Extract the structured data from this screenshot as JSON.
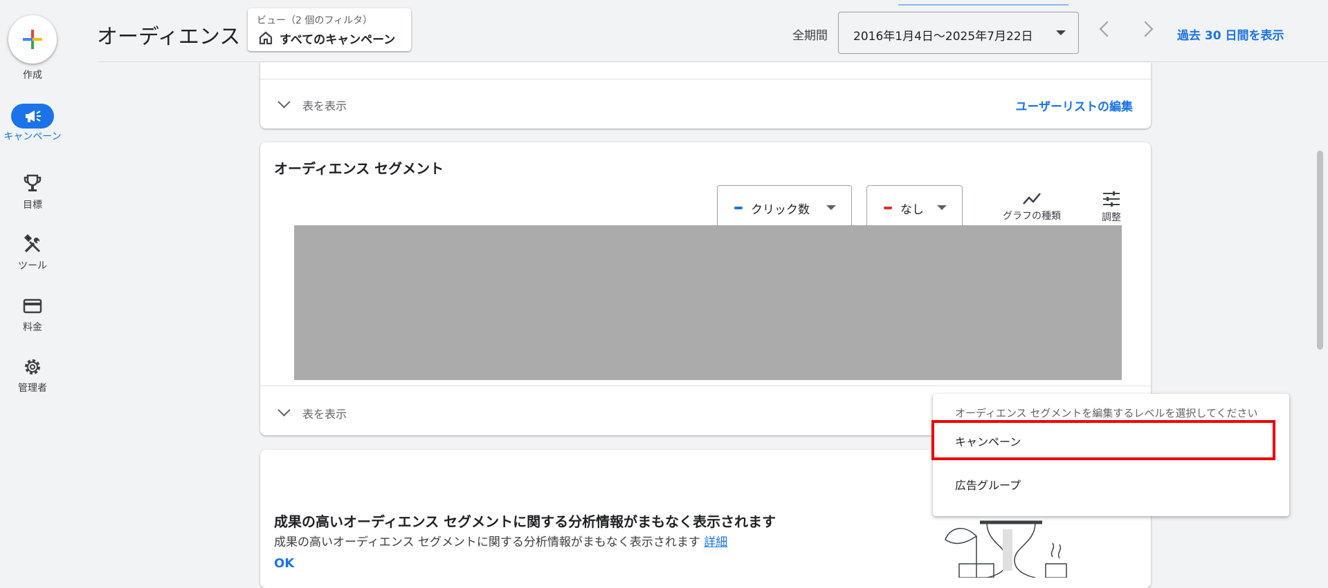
{
  "nav": {
    "create_label": "作成",
    "items": [
      {
        "label": "キャンペーン",
        "icon": "megaphone-icon",
        "active": true
      },
      {
        "label": "目標",
        "icon": "trophy-icon"
      },
      {
        "label": "ツール",
        "icon": "tools-icon"
      },
      {
        "label": "料金",
        "icon": "credit-card-icon"
      },
      {
        "label": "管理者",
        "icon": "gear-icon"
      }
    ]
  },
  "header": {
    "title": "オーディエンス",
    "view_chip": {
      "sub": "ビュー（2 個のフィルタ）",
      "main": "すべてのキャンペーン",
      "icon": "home-icon"
    },
    "period_label": "全期間",
    "date_range": "2016年1月4日～2025年7月22日",
    "past30_label": "過去 30 日間を表示"
  },
  "card_userlist": {
    "show_table": "表を表示",
    "edit_link": "ユーザーリストの編集"
  },
  "card_segments": {
    "title": "オーディエンス セグメント",
    "metric1": {
      "label": "クリック数",
      "color": "#1a73e8"
    },
    "metric2": {
      "label": "なし",
      "color": "#d93025"
    },
    "chart_type_label": "グラフの種類",
    "adjust_label": "調整",
    "show_table": "表を表示"
  },
  "card_insights": {
    "heading": "成果の高いオーディエンス セグメントに関する分析情報がまもなく表示されます",
    "text": "成果の高いオーディエンス セグメントに関する分析情報がまもなく表示されます",
    "link": "詳細",
    "ok": "OK"
  },
  "menu": {
    "hint": "オーディエンス セグメントを編集するレベルを選択してください",
    "items": [
      "キャンペーン",
      "広告グループ"
    ],
    "highlighted": "キャンペーン"
  }
}
